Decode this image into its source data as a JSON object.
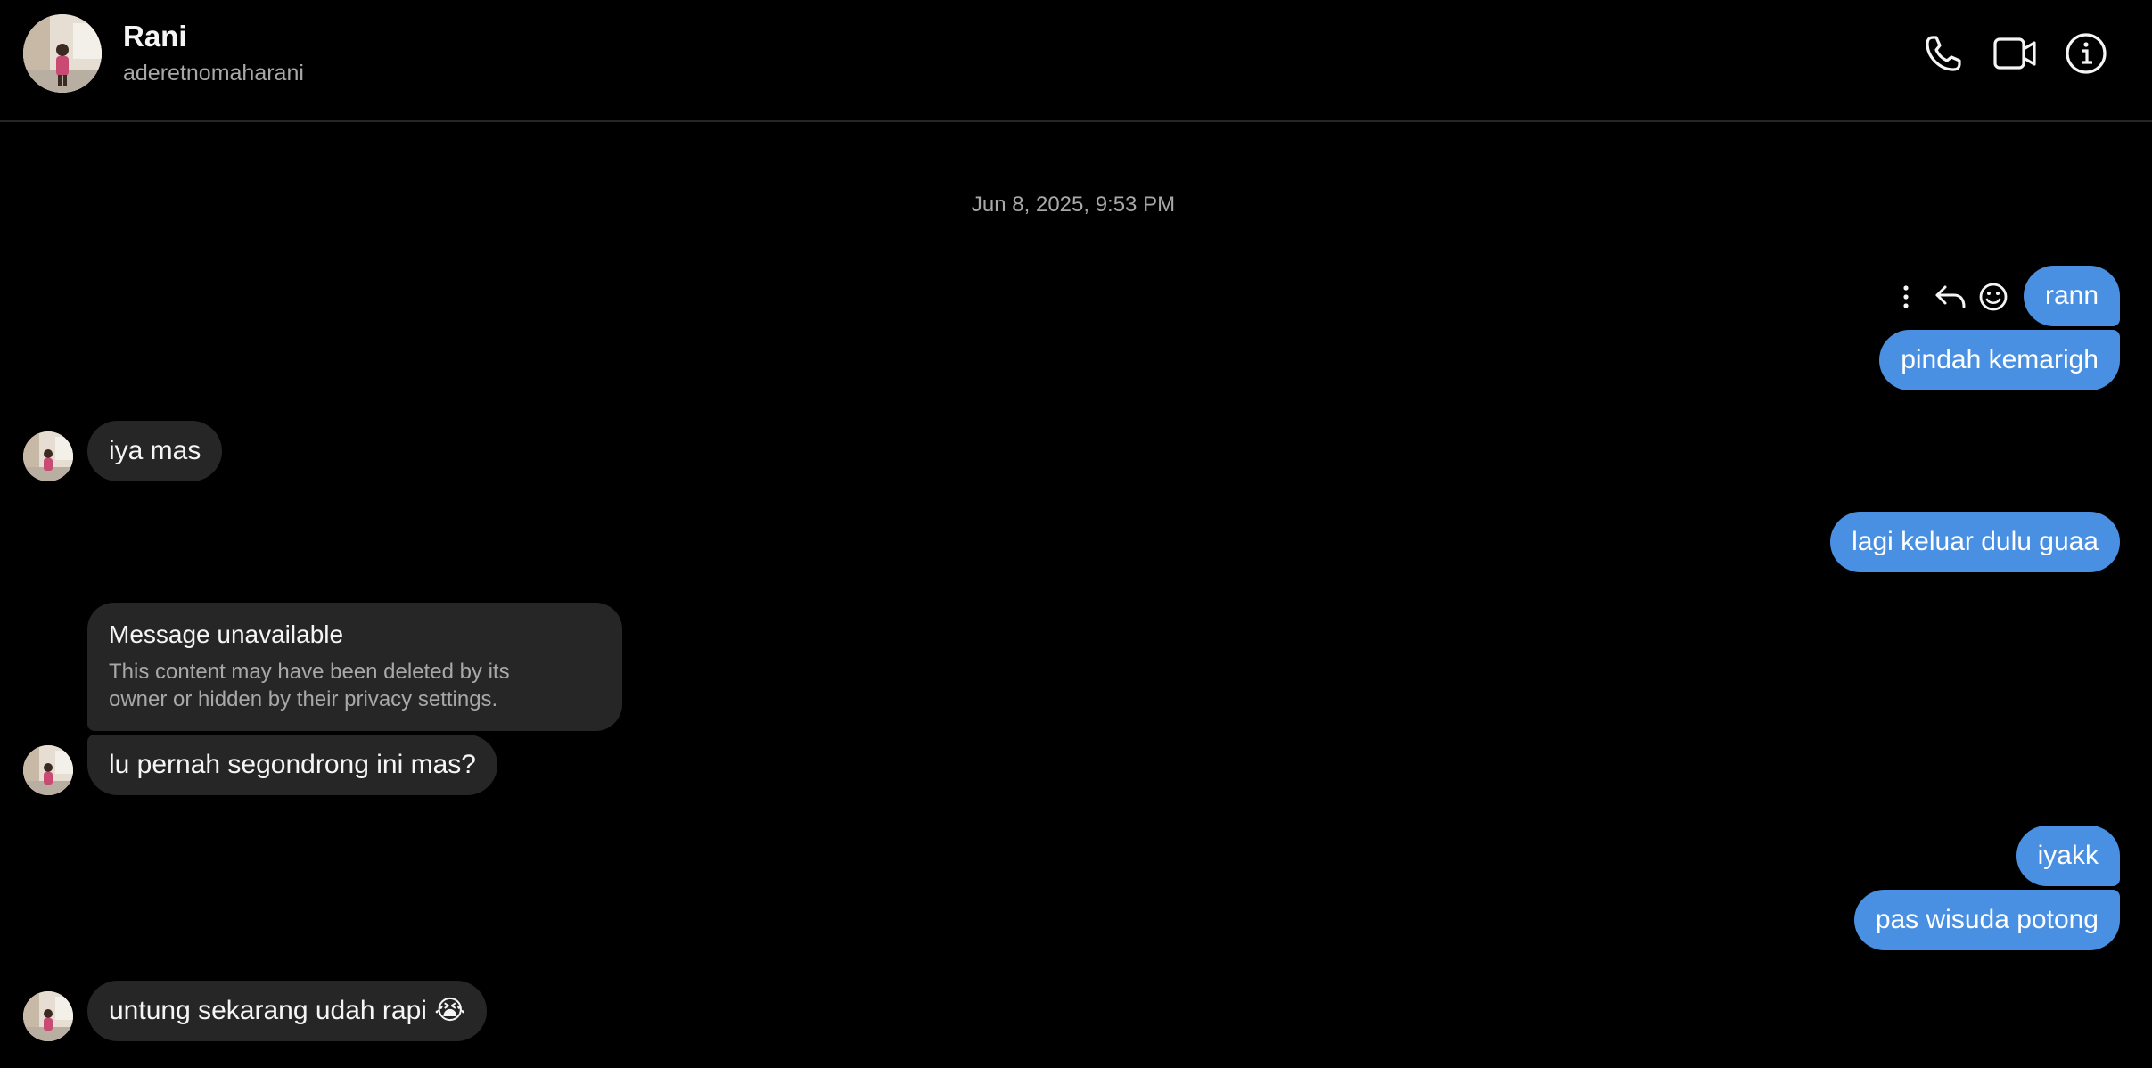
{
  "header": {
    "name": "Rani",
    "username": "aderetnomaharani",
    "actions": [
      "phone-call",
      "video-call",
      "conversation-info"
    ]
  },
  "conversation": {
    "timestamp": "Jun 8, 2025, 9:53 PM",
    "messages": [
      {
        "from": "me",
        "text": "rann"
      },
      {
        "from": "me",
        "text": "pindah kemarigh"
      },
      {
        "from": "them",
        "text": "iya mas"
      },
      {
        "from": "me",
        "text": "lagi keluar dulu guaa"
      },
      {
        "from": "them",
        "type": "unavailable",
        "title": "Message unavailable",
        "text": "This content may have been deleted by its owner or hidden by their privacy settings."
      },
      {
        "from": "them",
        "text": "lu pernah segondrong ini mas?"
      },
      {
        "from": "me",
        "text": "iyakk"
      },
      {
        "from": "me",
        "text": "pas wisuda potong"
      },
      {
        "from": "them",
        "text": "untung sekarang udah rapi 😭"
      }
    ]
  },
  "hover_actions": [
    "more-options",
    "reply",
    "react"
  ],
  "colors": {
    "background": "#000000",
    "outgoing_bubble": "#4a90e2",
    "incoming_bubble": "#262626",
    "secondary_text": "#a8a8a8",
    "divider": "#262626"
  }
}
